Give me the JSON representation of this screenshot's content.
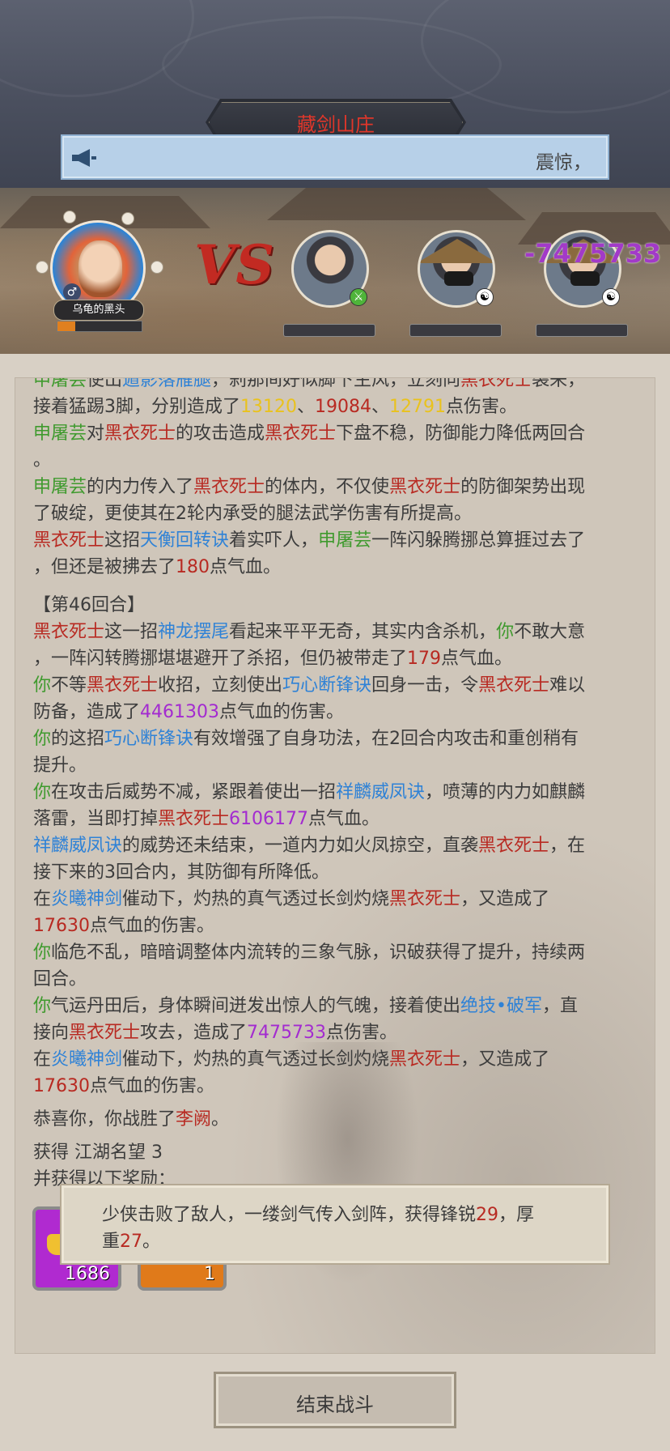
{
  "header": {
    "title": "藏剑山庄",
    "notice_text": "震惊，"
  },
  "battle": {
    "player_name": "乌龟的黑头",
    "player_gender_icon": "male-icon",
    "vs_text": "VS",
    "floating_damage": "-7475733",
    "enemies": [
      {
        "name": "",
        "badge": "sword-icon"
      },
      {
        "name": "",
        "badge": "yinyang-icon"
      },
      {
        "name": "",
        "badge": "yinyang-icon"
      }
    ]
  },
  "log": {
    "l1": {
      "a": "申屠芸",
      "b": "使出",
      "c": "遁影落雁腿",
      "d": "，刹那间好似脚下生风，立刻向",
      "e": "黑衣死士",
      "f": "袭来，"
    },
    "l2": {
      "a": "接着猛踢3脚，分别造成了",
      "n1": "13120",
      "s1": "、",
      "n2": "19084",
      "s2": "、",
      "n3": "12791",
      "z": "点伤害。"
    },
    "l3": {
      "a": "申屠芸",
      "b": "对",
      "c": "黑衣死士",
      "d": "的攻击造成",
      "e": "黑衣死士",
      "f": "下盘不稳，防御能力降低两回合"
    },
    "l4": "。",
    "l5": {
      "a": "申屠芸",
      "b": "的内力传入了",
      "c": "黑衣死士",
      "d": "的体内，不仅使",
      "e": "黑衣死士",
      "f": "的防御架势出现"
    },
    "l6": "了破绽，更使其在2轮内承受的腿法武学伤害有所提高。",
    "l7": {
      "a": "黑衣死士",
      "b": "这招",
      "c": "天衡回转诀",
      "d": "着实吓人，",
      "e": "申屠芸",
      "f": "一阵闪躲腾挪总算捱过去了"
    },
    "l8": {
      "a": "，但还是被拂去了",
      "b": "180",
      "c": "点气血。"
    },
    "round": "【第46回合】",
    "l9": {
      "a": "黑衣死士",
      "b": "这一招",
      "c": "神龙摆尾",
      "d": "看起来平平无奇，其实内含杀机，",
      "e": "你",
      "f": "不敢大意"
    },
    "l10": {
      "a": "，一阵闪转腾挪堪堪避开了杀招，但仍被带走了",
      "b": "179",
      "c": "点气血。"
    },
    "l11": {
      "a": "你",
      "b": "不等",
      "c": "黑衣死士",
      "d": "收招，立刻使出",
      "e": "巧心断锋诀",
      "f": "回身一击，令",
      "g": "黑衣死士",
      "h": "难以"
    },
    "l12": {
      "a": "防备，造成了",
      "b": "4461303",
      "c": "点气血的伤害。"
    },
    "l13": {
      "a": "你",
      "b": "的这招",
      "c": "巧心断锋诀",
      "d": "有效增强了自身功法，在2回合内攻击和重创稍有"
    },
    "l14": "提升。",
    "l15": {
      "a": "你",
      "b": "在攻击后威势不减，紧跟着使出一招",
      "c": "祥麟威凤诀",
      "d": "，喷薄的内力如麒麟"
    },
    "l16": {
      "a": "落雷，当即打掉",
      "b": "黑衣死士",
      "c": "6106177",
      "d": "点气血。"
    },
    "l17": {
      "a": "祥麟威凤诀",
      "b": "的威势还未结束，一道内力如火凤掠空，直袭",
      "c": "黑衣死士",
      "d": "，在"
    },
    "l18": "接下来的3回合内，其防御有所降低。",
    "l19": {
      "a": "在",
      "b": "炎曦神剑",
      "c": "催动下，灼热的真气透过长剑灼烧",
      "d": "黑衣死士",
      "e": "，又造成了"
    },
    "l20": {
      "a": "17630",
      "b": "点气血的伤害。"
    },
    "l21": {
      "a": "你",
      "b": "临危不乱，暗暗调整体内流转的三象气脉，识破获得了提升，持续两"
    },
    "l22": "回合。",
    "l23": {
      "a": "你",
      "b": "气运丹田后，身体瞬间迸发出惊人的气魄，接着使出",
      "c": "绝技•破军",
      "d": "，直"
    },
    "l24": {
      "a": "接向",
      "b": "黑衣死士",
      "c": "攻去，造成了",
      "d": "7475733",
      "e": "点伤害。"
    },
    "l25": {
      "a": "在",
      "b": "炎曦神剑",
      "c": "催动下，灼热的真气透过长剑灼烧",
      "d": "黑衣死士",
      "e": "，又造成了"
    },
    "l26": {
      "a": "17630",
      "b": "点气血的伤害。"
    },
    "victory": {
      "a": "恭喜你，你战胜了",
      "b": "李阙",
      "c": "。"
    },
    "gain": "获得 江湖名望 3",
    "extra": "并获得以下奖励："
  },
  "rewards": [
    {
      "icon": "gold-ingot-icon",
      "quantity": "1686",
      "color": "#b02ad0"
    },
    {
      "icon": "scroll-icon",
      "quantity": "1",
      "color": "#e07a1a"
    }
  ],
  "toast": {
    "a": "少侠击败了敌人，一缕剑气传入剑阵，获得锋锐",
    "b": "29",
    "c": "，厚",
    "d": "重",
    "e": "27",
    "f": "。"
  },
  "end_button": "结束战斗"
}
